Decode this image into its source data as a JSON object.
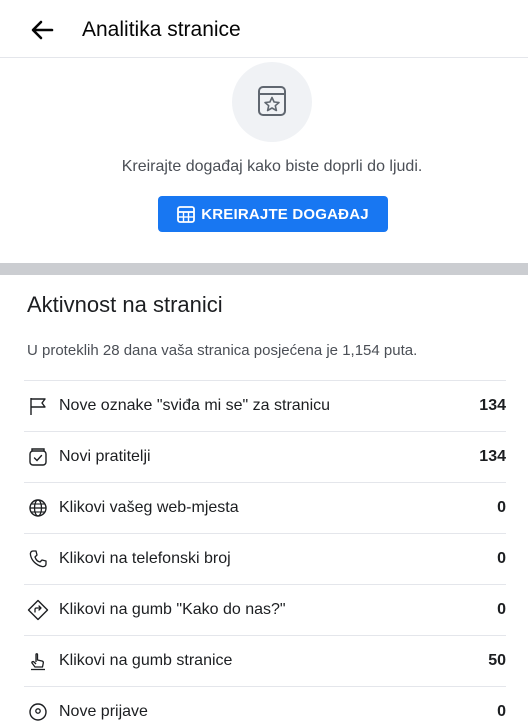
{
  "header": {
    "title": "Analitika stranice",
    "back_icon": "arrow-left-icon"
  },
  "event_promo": {
    "icon": "calendar-star-icon",
    "text": "Kreirajte događaj kako biste doprli do ljudi.",
    "button_label": "KREIRAJTE DOGAĐAJ",
    "button_icon": "calendar-grid-icon",
    "button_color": "#1877f2"
  },
  "activity": {
    "title": "Aktivnost na stranici",
    "subtitle": "U proteklih 28 dana vaša stranica posjećena je 1,154 puta.",
    "rows": [
      {
        "icon": "flag-icon",
        "label": "Nove oznake \"sviđa mi se\" za stranicu",
        "value": "134"
      },
      {
        "icon": "follow-icon",
        "label": "Novi pratitelji",
        "value": "134"
      },
      {
        "icon": "globe-icon",
        "label": "Klikovi vašeg web-mjesta",
        "value": "0"
      },
      {
        "icon": "phone-icon",
        "label": "Klikovi na telefonski broj",
        "value": "0"
      },
      {
        "icon": "directions-icon",
        "label": "Klikovi na gumb \"Kako do nas?\"",
        "value": "0"
      },
      {
        "icon": "tap-icon",
        "label": "Klikovi na gumb stranice",
        "value": "50"
      },
      {
        "icon": "location-pin-icon",
        "label": "Nove prijave",
        "value": "0"
      }
    ]
  }
}
